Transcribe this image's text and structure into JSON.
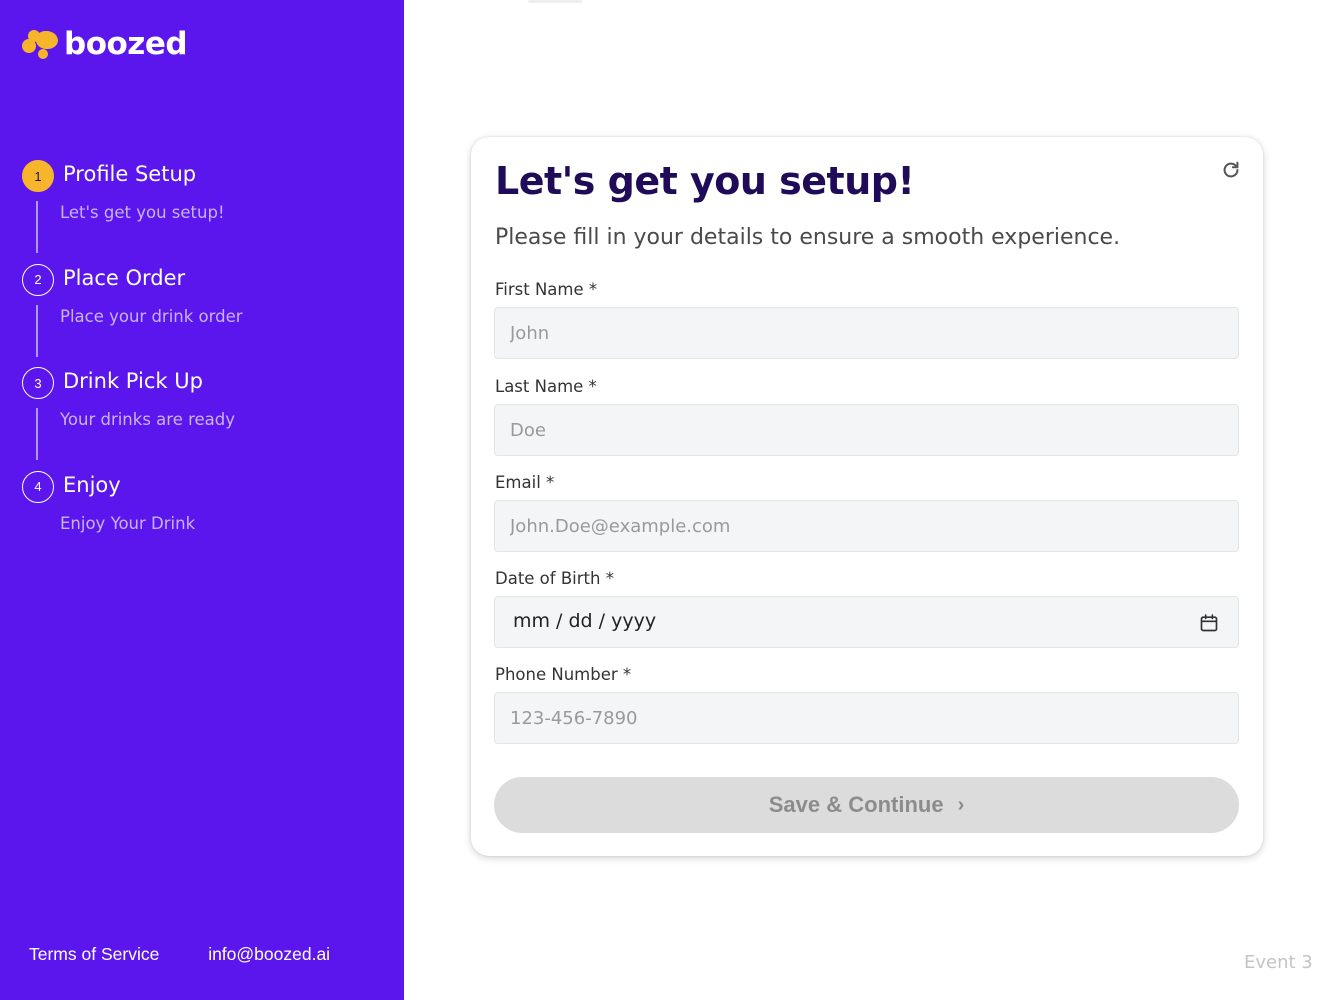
{
  "brand": {
    "name": "boozed"
  },
  "steps": [
    {
      "number": "1",
      "title": "Profile Setup",
      "subtitle": "Let's get you setup!"
    },
    {
      "number": "2",
      "title": "Place Order",
      "subtitle": "Place your drink order"
    },
    {
      "number": "3",
      "title": "Drink Pick Up",
      "subtitle": "Your drinks are ready"
    },
    {
      "number": "4",
      "title": "Enjoy",
      "subtitle": "Enjoy Your Drink"
    }
  ],
  "footer": {
    "terms": "Terms of Service",
    "email": "info@boozed.ai"
  },
  "form": {
    "title": "Let's get you setup!",
    "subtitle": "Please fill in your details to ensure a smooth experience.",
    "first_name": {
      "label": "First Name *",
      "placeholder": "John"
    },
    "last_name": {
      "label": "Last Name *",
      "placeholder": "Doe"
    },
    "email": {
      "label": "Email *",
      "placeholder": "John.Doe@example.com"
    },
    "dob": {
      "label": "Date of Birth *",
      "value": "mm / dd / yyyy"
    },
    "phone": {
      "label": "Phone Number *",
      "placeholder": "123-456-7890"
    },
    "submit": {
      "label": "Save & Continue",
      "chevron": "›"
    }
  },
  "event_label": "Event 3",
  "colors": {
    "sidebar": "#5b16ed",
    "accent": "#f7b52c",
    "title": "#1f0b57"
  },
  "icons": [
    "refresh-icon",
    "calendar-icon",
    "chevron-right-icon"
  ]
}
